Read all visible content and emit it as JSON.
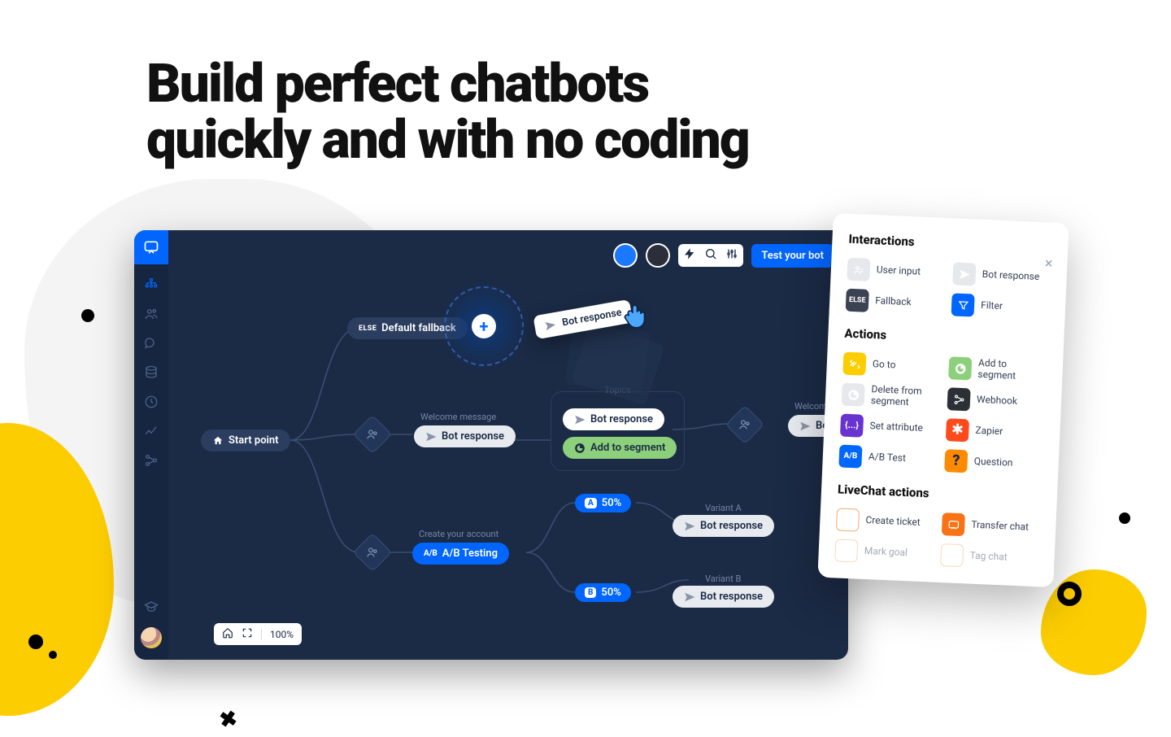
{
  "headline": "Build perfect chatbots\nquickly and with no coding",
  "topbar": {
    "test_button": "Test your bot"
  },
  "zoom": {
    "value": "100%"
  },
  "nodes": {
    "start_point": "Start point",
    "default_fallback_prefix": "ELSE",
    "default_fallback": "Default fallback",
    "welcome_label": "Welcome message",
    "bot_response": "Bot response",
    "topics_label": "Topics",
    "add_to_segment": "Add to segment",
    "create_account_label": "Create your account",
    "ab_testing": "A/B Testing",
    "variant_a_badge": "A",
    "variant_b_badge": "B",
    "fifty": "50%",
    "variant_a_label": "Variant A",
    "variant_b_label": "Variant B",
    "welcome_right": "Welcom"
  },
  "drag_card": "Bot response",
  "panel": {
    "close": "×",
    "sections": {
      "interactions": {
        "title": "Interactions",
        "items": {
          "user_input": "User input",
          "bot_response": "Bot response",
          "fallback_prefix": "ELSE",
          "fallback": "Fallback",
          "filter": "Filter"
        }
      },
      "actions": {
        "title": "Actions",
        "items": {
          "go_to": "Go to",
          "add_to_segment": "Add to segment",
          "delete_from_segment": "Delete from segment",
          "webhook": "Webhook",
          "set_attribute": "Set attribute",
          "zapier": "Zapier",
          "ab_test": "A/B Test",
          "question": "Question"
        }
      },
      "livechat": {
        "title": "LiveChat actions",
        "items": {
          "create_ticket": "Create ticket",
          "transfer_chat": "Transfer chat",
          "mark_goal": "Mark goal",
          "tag_chat": "Tag chat"
        }
      }
    }
  }
}
